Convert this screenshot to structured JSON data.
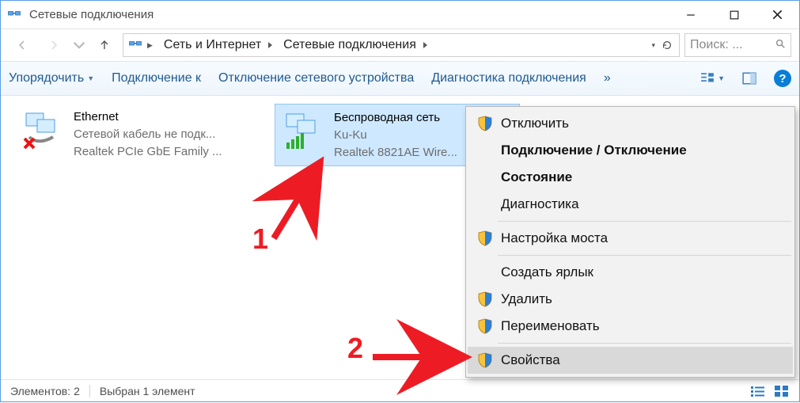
{
  "window": {
    "title": "Сетевые подключения"
  },
  "breadcrumb": {
    "parent": "Сеть и Интернет",
    "current": "Сетевые подключения"
  },
  "search": {
    "placeholder": "Поиск: ..."
  },
  "toolbar": {
    "organize": "Упорядочить",
    "connect_to": "Подключение к",
    "disable_device": "Отключение сетевого устройства",
    "diagnose": "Диагностика подключения",
    "overflow": "»"
  },
  "items": [
    {
      "name": "Ethernet",
      "status": "Сетевой кабель не подк...",
      "device": "Realtek PCIe GbE Family ..."
    },
    {
      "name": "Беспроводная сеть",
      "status": "Ku-Ku",
      "device": "Realtek 8821AE Wire..."
    }
  ],
  "context_menu": {
    "disable": "Отключить",
    "connect_disconnect": "Подключение / Отключение",
    "status": "Состояние",
    "diagnose": "Диагностика",
    "bridge": "Настройка моста",
    "shortcut": "Создать ярлык",
    "delete": "Удалить",
    "rename": "Переименовать",
    "properties": "Свойства"
  },
  "statusbar": {
    "count_label": "Элементов:",
    "count_value": "2",
    "selected": "Выбран 1 элемент"
  },
  "annotations": {
    "num1": "1",
    "num2": "2"
  }
}
